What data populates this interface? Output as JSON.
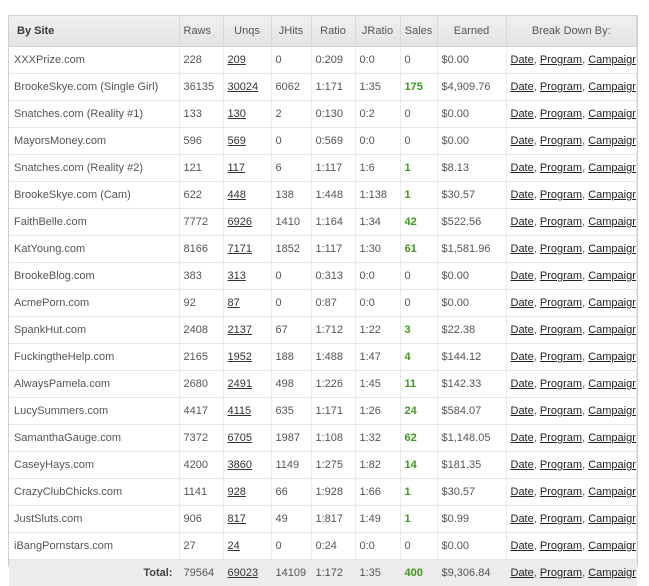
{
  "header": {
    "site": "By Site",
    "raws": "Raws",
    "unqs": "Unqs",
    "jhits": "JHits",
    "ratio": "Ratio",
    "jratio": "JRatio",
    "sales": "Sales",
    "earned": "Earned",
    "breakdown": "Break Down By:"
  },
  "breakdown_links": {
    "date": "Date",
    "program": "Program",
    "campaign": "Campaign"
  },
  "rows": [
    {
      "site": "XXXPrize.com",
      "raws": "228",
      "unqs": "209",
      "jhits": "0",
      "ratio": "0:209",
      "jratio": "0:0",
      "sales": "0",
      "earned": "$0.00"
    },
    {
      "site": "BrookeSkye.com (Single Girl)",
      "raws": "36135",
      "unqs": "30024",
      "jhits": "6062",
      "ratio": "1:171",
      "jratio": "1:35",
      "sales": "175",
      "earned": "$4,909.76"
    },
    {
      "site": "Snatches.com (Reality #1)",
      "raws": "133",
      "unqs": "130",
      "jhits": "2",
      "ratio": "0:130",
      "jratio": "0:2",
      "sales": "0",
      "earned": "$0.00"
    },
    {
      "site": "MayorsMoney.com",
      "raws": "596",
      "unqs": "569",
      "jhits": "0",
      "ratio": "0:569",
      "jratio": "0:0",
      "sales": "0",
      "earned": "$0.00"
    },
    {
      "site": "Snatches.com (Reality #2)",
      "raws": "121",
      "unqs": "117",
      "jhits": "6",
      "ratio": "1:117",
      "jratio": "1:6",
      "sales": "1",
      "earned": "$8.13"
    },
    {
      "site": "BrookeSkye.com (Cam)",
      "raws": "622",
      "unqs": "448",
      "jhits": "138",
      "ratio": "1:448",
      "jratio": "1:138",
      "sales": "1",
      "earned": "$30.57"
    },
    {
      "site": "FaithBelle.com",
      "raws": "7772",
      "unqs": "6926",
      "jhits": "1410",
      "ratio": "1:164",
      "jratio": "1:34",
      "sales": "42",
      "earned": "$522.56"
    },
    {
      "site": "KatYoung.com",
      "raws": "8166",
      "unqs": "7171",
      "jhits": "1852",
      "ratio": "1:117",
      "jratio": "1:30",
      "sales": "61",
      "earned": "$1,581.96"
    },
    {
      "site": "BrookeBlog.com",
      "raws": "383",
      "unqs": "313",
      "jhits": "0",
      "ratio": "0:313",
      "jratio": "0:0",
      "sales": "0",
      "earned": "$0.00"
    },
    {
      "site": "AcmePorn.com",
      "raws": "92",
      "unqs": "87",
      "jhits": "0",
      "ratio": "0:87",
      "jratio": "0:0",
      "sales": "0",
      "earned": "$0.00"
    },
    {
      "site": "SpankHut.com",
      "raws": "2408",
      "unqs": "2137",
      "jhits": "67",
      "ratio": "1:712",
      "jratio": "1:22",
      "sales": "3",
      "earned": "$22.38"
    },
    {
      "site": "FuckingtheHelp.com",
      "raws": "2165",
      "unqs": "1952",
      "jhits": "188",
      "ratio": "1:488",
      "jratio": "1:47",
      "sales": "4",
      "earned": "$144.12"
    },
    {
      "site": "AlwaysPamela.com",
      "raws": "2680",
      "unqs": "2491",
      "jhits": "498",
      "ratio": "1:226",
      "jratio": "1:45",
      "sales": "11",
      "earned": "$142.33"
    },
    {
      "site": "LucySummers.com",
      "raws": "4417",
      "unqs": "4115",
      "jhits": "635",
      "ratio": "1:171",
      "jratio": "1:26",
      "sales": "24",
      "earned": "$584.07"
    },
    {
      "site": "SamanthaGauge.com",
      "raws": "7372",
      "unqs": "6705",
      "jhits": "1987",
      "ratio": "1:108",
      "jratio": "1:32",
      "sales": "62",
      "earned": "$1,148.05"
    },
    {
      "site": "CaseyHays.com",
      "raws": "4200",
      "unqs": "3860",
      "jhits": "1149",
      "ratio": "1:275",
      "jratio": "1:82",
      "sales": "14",
      "earned": "$181.35"
    },
    {
      "site": "CrazyClubChicks.com",
      "raws": "1141",
      "unqs": "928",
      "jhits": "66",
      "ratio": "1:928",
      "jratio": "1:66",
      "sales": "1",
      "earned": "$30.57"
    },
    {
      "site": "JustSluts.com",
      "raws": "906",
      "unqs": "817",
      "jhits": "49",
      "ratio": "1:817",
      "jratio": "1:49",
      "sales": "1",
      "earned": "$0.99"
    },
    {
      "site": "iBangPornstars.com",
      "raws": "27",
      "unqs": "24",
      "jhits": "0",
      "ratio": "0:24",
      "jratio": "0:0",
      "sales": "0",
      "earned": "$0.00"
    }
  ],
  "total": {
    "label": "Total:",
    "raws": "79564",
    "unqs": "69023",
    "jhits": "14109",
    "ratio": "1:172",
    "jratio": "1:35",
    "sales": "400",
    "earned": "$9,306.84"
  },
  "colors": {
    "positive_sales": "#3c9a19",
    "header_bg": "#e8e8e8",
    "total_bg": "#ececec"
  }
}
